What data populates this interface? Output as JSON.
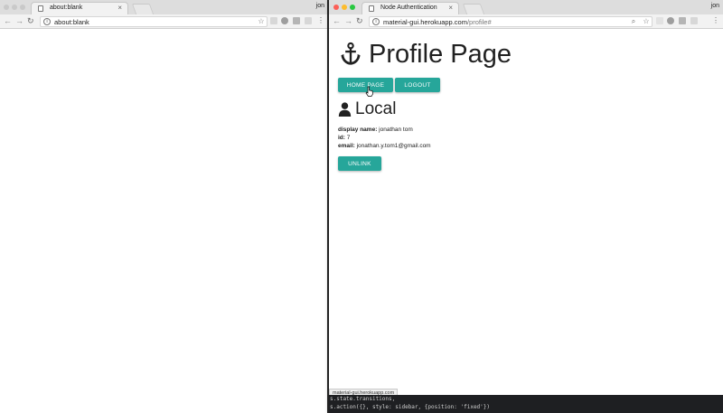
{
  "left_window": {
    "tab_title": "about:blank",
    "url": "about:blank",
    "user": "jon"
  },
  "right_window": {
    "tab_title": "Node Authentication",
    "url_host": "material-gui.herokuapp.com",
    "url_path": "/profile#",
    "user": "jon",
    "page": {
      "title": "Profile Page",
      "buttons": [
        "HOME PAGE",
        "LOGOUT"
      ],
      "section_title": "Local",
      "fields": [
        {
          "label": "display name",
          "value": "jonathan tom"
        },
        {
          "label": "id",
          "value": "7"
        },
        {
          "label": "email",
          "value": "jonathan.y.tom1@gmail.com"
        }
      ],
      "unlink_label": "UNLINK"
    },
    "status_url": "material-gui.herokuapp.com",
    "terminal_lines": [
      "s.state.transitions,",
      "",
      "s.action({}, style: sidebar, {position: 'fixed'})"
    ]
  },
  "colors": {
    "accent": "#26a69a",
    "terminal_bg": "#1e1f22"
  }
}
